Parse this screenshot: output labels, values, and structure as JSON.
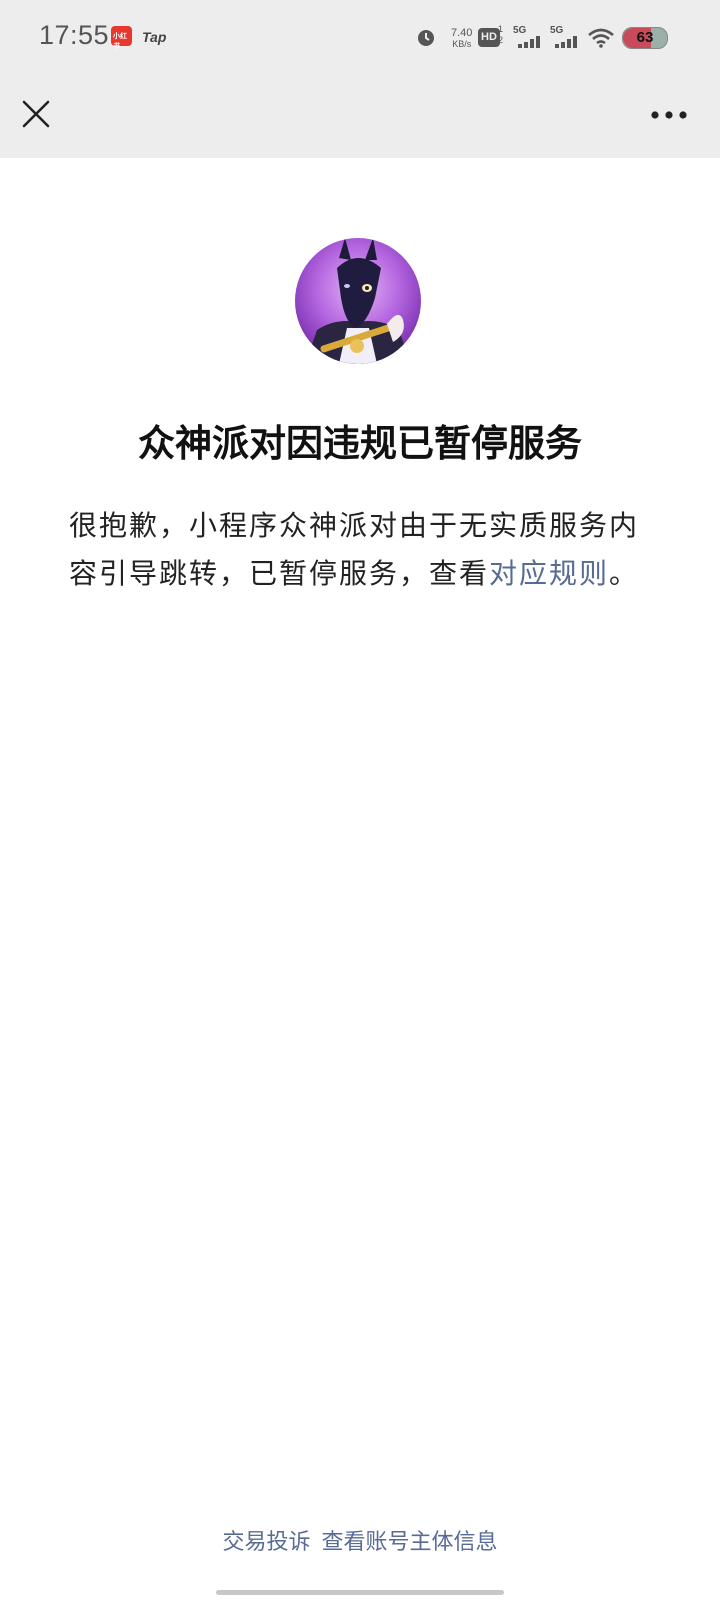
{
  "status_bar": {
    "time": "17:55",
    "app_icon_label": "小红书",
    "tap_label": "Tap",
    "net_speed_value": "7.40",
    "net_speed_unit": "KB/s",
    "hd_label": "HD",
    "hd_sub_top": "1",
    "hd_sub_bottom": "2",
    "sim1_label": "5G",
    "sim2_label": "5G",
    "battery": "63"
  },
  "navbar": {
    "close_icon": "close-icon",
    "more_icon": "more-icon"
  },
  "notice": {
    "title": "众神派对因违规已暂停服务",
    "desc_prefix": "很抱歉，小程序众神派对由于无实质服务内容引导跳转，已暂停服务，查看",
    "desc_link": "对应规则",
    "desc_suffix": "。"
  },
  "footer": {
    "complaint_link": "交易投诉",
    "account_info_link": "查看账号主体信息"
  },
  "colors": {
    "link": "#576b95",
    "header_bg": "#ededed"
  }
}
